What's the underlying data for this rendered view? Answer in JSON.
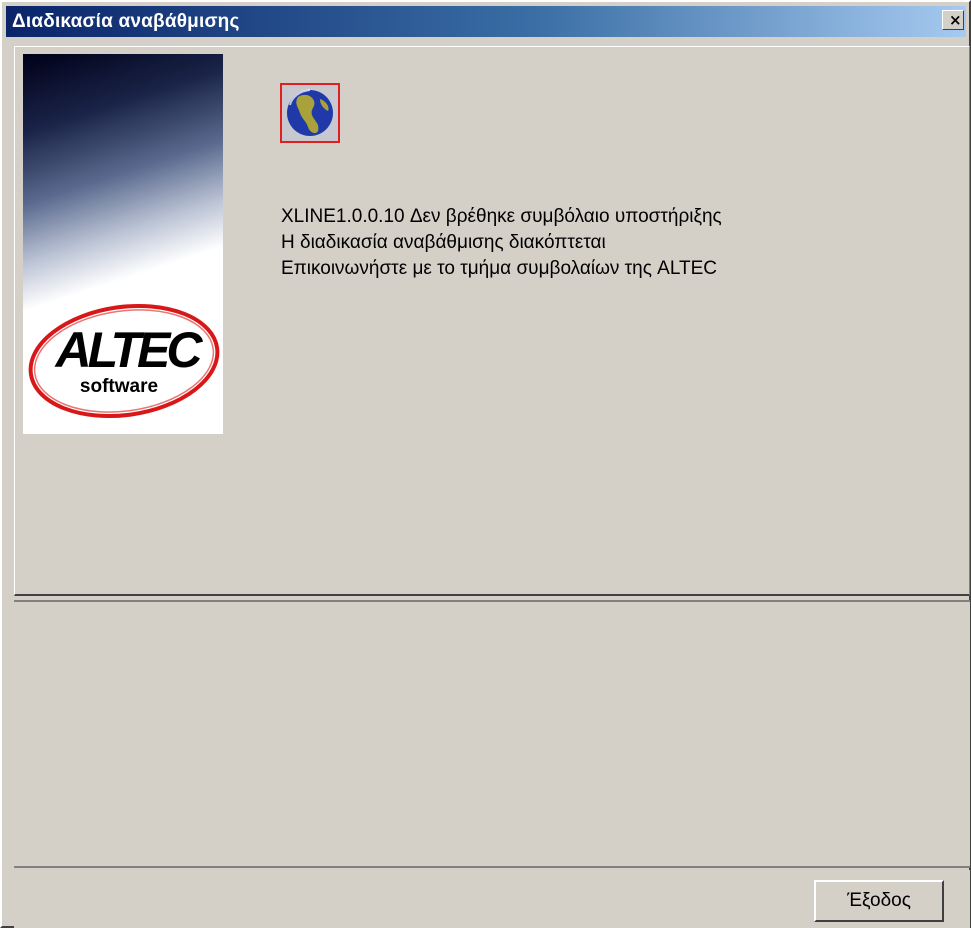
{
  "window": {
    "title": "Διαδικασία αναβάθμισης",
    "close_glyph": "×"
  },
  "banner": {
    "logo_text": "ALTEC",
    "logo_subtext": "software",
    "logo_ring_color": "#d81818"
  },
  "icon": {
    "name": "globe-icon",
    "border_color": "#e02020"
  },
  "message": {
    "line1": "XLINE1.0.0.10 Δεν βρέθηκε συμβόλαιο υποστήριξης",
    "line2": "Η διαδικασία αναβάθμισης διακόπτεται",
    "line3": "Επικοινωνήστε με το τμήμα συμβολαίων της ALTEC"
  },
  "footer": {
    "exit_label": "Έξοδος"
  },
  "colors": {
    "face": "#d4d0c8",
    "title_start": "#0a246a",
    "title_end": "#a6caf0"
  }
}
